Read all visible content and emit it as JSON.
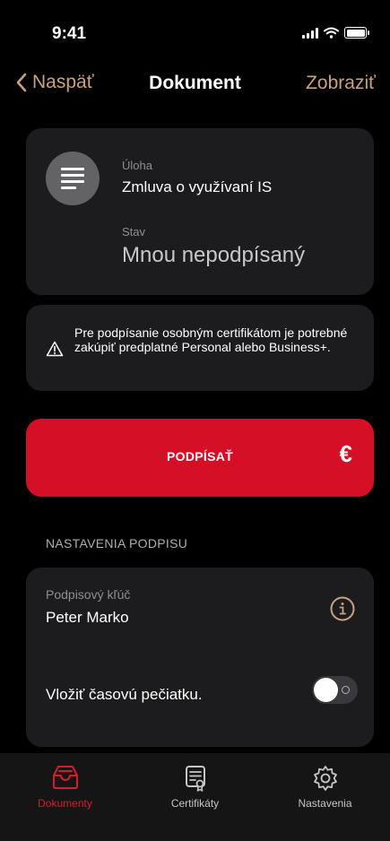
{
  "status_bar": {
    "time": "9:41"
  },
  "nav": {
    "back_label": "Naspäť",
    "title": "Dokument",
    "action_label": "Zobraziť"
  },
  "document": {
    "task_label": "Úloha",
    "task_value": "Zmluva o využívaní IS",
    "status_label": "Stav",
    "status_value": "Mnou nepodpísaný",
    "icon": "document-icon"
  },
  "warning": {
    "icon": "warning-icon",
    "text": "Pre podpísanie osobným certifikátom je potrebné zakúpiť predplatné Personal alebo Business+."
  },
  "sign_button": {
    "label": "PODPÍSAŤ",
    "icon": "€"
  },
  "signature_settings": {
    "header": "NASTAVENIA PODPISU",
    "key_label": "Podpisový kľúč",
    "key_value": "Peter Marko",
    "timestamp_label": "Vložiť časovú pečiatku.",
    "timestamp_enabled": false
  },
  "tab_bar": {
    "active": "Dokumenty",
    "items": [
      {
        "label": "Dokumenty",
        "icon": "inbox-tray-icon"
      },
      {
        "label": "Certifikáty",
        "icon": "certificate-icon"
      },
      {
        "label": "Nastavenia",
        "icon": "gear-icon"
      }
    ]
  },
  "colors": {
    "accent": "#c9a27e",
    "danger": "#d50f25",
    "card": "#1c1c1e",
    "background": "#000000",
    "tab_active": "#d0202f",
    "tab_inactive": "#c6c6c8"
  }
}
